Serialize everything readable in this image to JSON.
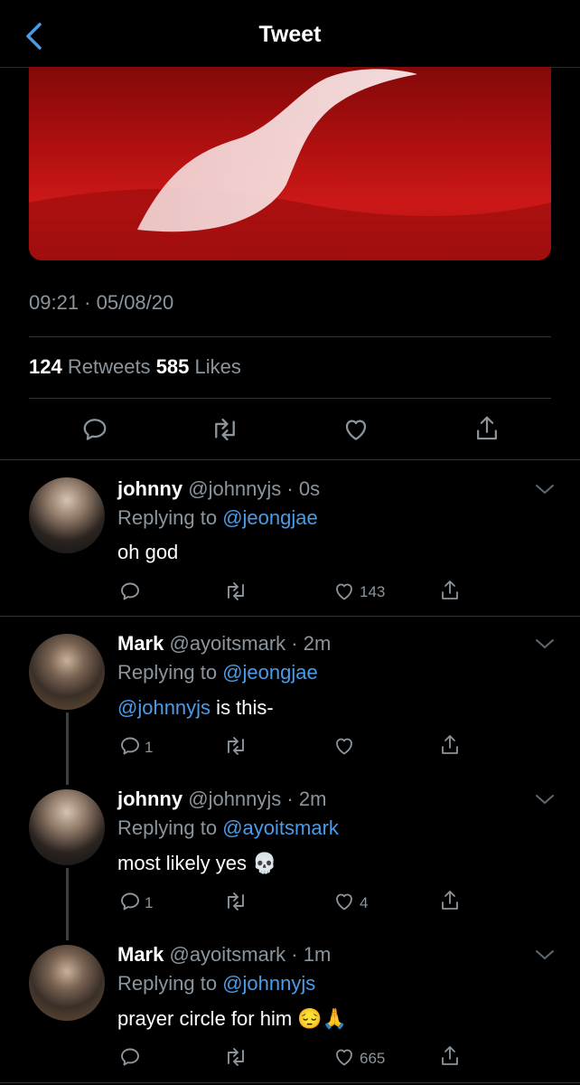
{
  "header": {
    "title": "Tweet"
  },
  "tweet": {
    "timestamp": "09:21 · 05/08/20",
    "retweets_count": "124",
    "retweets_label": "Retweets",
    "likes_count": "585",
    "likes_label": "Likes"
  },
  "replies": [
    {
      "name": "johnny",
      "handle": "@johnnyjs",
      "time": "0s",
      "replying_label": "Replying to",
      "replying_to": "@jeongjae",
      "mention": "",
      "text": "oh god",
      "emoji": "",
      "reply_count": "",
      "retweet_count": "",
      "like_count": "143"
    },
    {
      "name": "Mark",
      "handle": "@ayoitsmark",
      "time": "2m",
      "replying_label": "Replying to",
      "replying_to": "@jeongjae",
      "mention": "@johnnyjs",
      "text": " is this-",
      "emoji": "",
      "reply_count": "1",
      "retweet_count": "",
      "like_count": ""
    },
    {
      "name": "johnny",
      "handle": "@johnnyjs",
      "time": "2m",
      "replying_label": "Replying to",
      "replying_to": "@ayoitsmark",
      "mention": "",
      "text": "most likely yes",
      "emoji": "💀",
      "reply_count": "1",
      "retweet_count": "",
      "like_count": "4"
    },
    {
      "name": "Mark",
      "handle": "@ayoitsmark",
      "time": "1m",
      "replying_label": "Replying to",
      "replying_to": "@johnnyjs",
      "mention": "",
      "text": "prayer circle for him",
      "emoji": "😔🙏",
      "reply_count": "",
      "retweet_count": "",
      "like_count": "665"
    }
  ],
  "colors": {
    "background": "#000000",
    "accent": "#4a9be8",
    "muted": "#8b959d",
    "divider": "#2f3336"
  },
  "icons": [
    "chevron-left-icon",
    "reply-icon",
    "retweet-icon",
    "heart-icon",
    "share-icon",
    "chevron-down-icon"
  ]
}
